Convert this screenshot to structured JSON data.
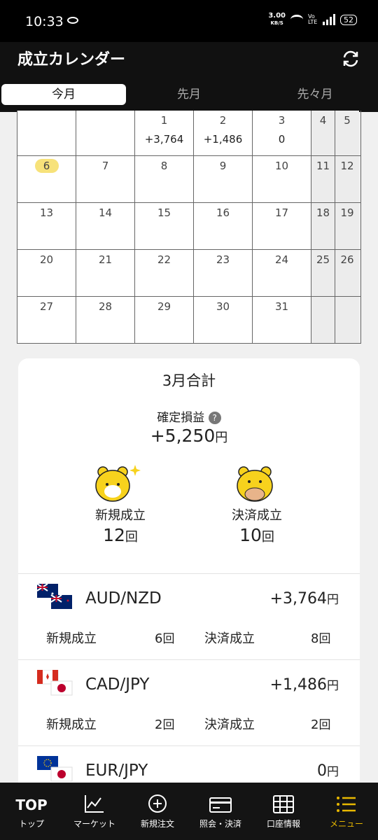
{
  "status": {
    "time": "10:33",
    "speed": "3.00",
    "speed_unit": "KB/S",
    "volte": "Vo LTE",
    "battery": "52"
  },
  "header": {
    "title": "成立カレンダー",
    "refresh_icon": "refresh-icon"
  },
  "tabs": [
    "今月",
    "先月",
    "先々月"
  ],
  "calendar": {
    "rows": [
      [
        {
          "d": "",
          "pl": ""
        },
        {
          "d": "",
          "pl": ""
        },
        {
          "d": "1",
          "pl": "+3,764"
        },
        {
          "d": "2",
          "pl": "+1,486"
        },
        {
          "d": "3",
          "pl": "0"
        },
        {
          "d": "4",
          "pl": ""
        },
        {
          "d": "5",
          "pl": ""
        }
      ],
      [
        {
          "d": "6",
          "pl": ""
        },
        {
          "d": "7",
          "pl": ""
        },
        {
          "d": "8",
          "pl": ""
        },
        {
          "d": "9",
          "pl": ""
        },
        {
          "d": "10",
          "pl": ""
        },
        {
          "d": "11",
          "pl": ""
        },
        {
          "d": "12",
          "pl": ""
        }
      ],
      [
        {
          "d": "13",
          "pl": ""
        },
        {
          "d": "14",
          "pl": ""
        },
        {
          "d": "15",
          "pl": ""
        },
        {
          "d": "16",
          "pl": ""
        },
        {
          "d": "17",
          "pl": ""
        },
        {
          "d": "18",
          "pl": ""
        },
        {
          "d": "19",
          "pl": ""
        }
      ],
      [
        {
          "d": "20",
          "pl": ""
        },
        {
          "d": "21",
          "pl": ""
        },
        {
          "d": "22",
          "pl": ""
        },
        {
          "d": "23",
          "pl": ""
        },
        {
          "d": "24",
          "pl": ""
        },
        {
          "d": "25",
          "pl": ""
        },
        {
          "d": "26",
          "pl": ""
        }
      ],
      [
        {
          "d": "27",
          "pl": ""
        },
        {
          "d": "28",
          "pl": ""
        },
        {
          "d": "29",
          "pl": ""
        },
        {
          "d": "30",
          "pl": ""
        },
        {
          "d": "31",
          "pl": ""
        },
        {
          "d": "",
          "pl": ""
        },
        {
          "d": "",
          "pl": ""
        }
      ]
    ],
    "today": "6"
  },
  "summary": {
    "title": "3月合計",
    "pl_label": "確定損益",
    "help": "?",
    "pl_value": "+5,250",
    "yen": "円",
    "new_label": "新規成立",
    "new_count": "12",
    "settle_label": "決済成立",
    "settle_count": "10",
    "times": "回"
  },
  "pairs": [
    {
      "name": "AUD/NZD",
      "pl": "+3,764",
      "new": "6",
      "settle": "8"
    },
    {
      "name": "CAD/JPY",
      "pl": "+1,486",
      "new": "2",
      "settle": "2"
    },
    {
      "name": "EUR/JPY",
      "pl": "0"
    }
  ],
  "nav": [
    {
      "top": "TOP",
      "label": "トップ"
    },
    {
      "label": "マーケット"
    },
    {
      "label": "新規注文"
    },
    {
      "label": "照会・決済"
    },
    {
      "label": "口座情報"
    },
    {
      "label": "メニュー"
    }
  ],
  "colors": {
    "accent": "#e8b800",
    "today_highlight": "#f7e27a",
    "header_bg": "#111111"
  }
}
